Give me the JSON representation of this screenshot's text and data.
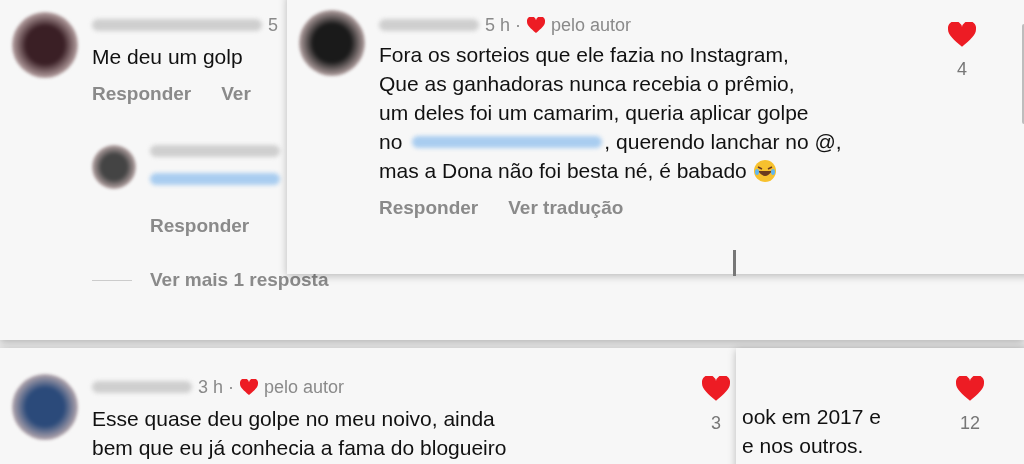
{
  "cards": [
    {
      "time": "5",
      "lines": [
        {
          "text": "Me deu um golp"
        }
      ],
      "actions": [
        "Responder",
        "Ver"
      ],
      "reply": {
        "action": "Responder"
      },
      "more_replies": "Ver mais 1 resposta"
    },
    {
      "time": "5 h ·",
      "author_like": "pelo autor",
      "lines": [
        {
          "text": "Fora os sorteios que ele fazia no Instagram,"
        },
        {
          "text": "Que as ganhadoras nunca recebia o prêmio,"
        },
        {
          "text": "um deles foi um camarim, queria aplicar golpe"
        },
        {
          "text": "no",
          "after_mention": ", querendo lanchar no @,"
        },
        {
          "text": "mas a Dona não foi besta né, é babado",
          "emoji": true
        }
      ],
      "actions": [
        "Responder",
        "Ver tradução"
      ],
      "likes": "4"
    },
    {
      "time": "3 h ·",
      "author_like": "pelo autor",
      "lines": [
        {
          "text": "Esse quase deu golpe no meu noivo, ainda"
        },
        {
          "text": "bem que eu já conhecia a fama do blogueiro"
        }
      ],
      "likes": "3"
    },
    {
      "lines": [
        {
          "text": "ook em 2017 e"
        },
        {
          "text": "e nos outros."
        }
      ],
      "likes": "12"
    }
  ]
}
